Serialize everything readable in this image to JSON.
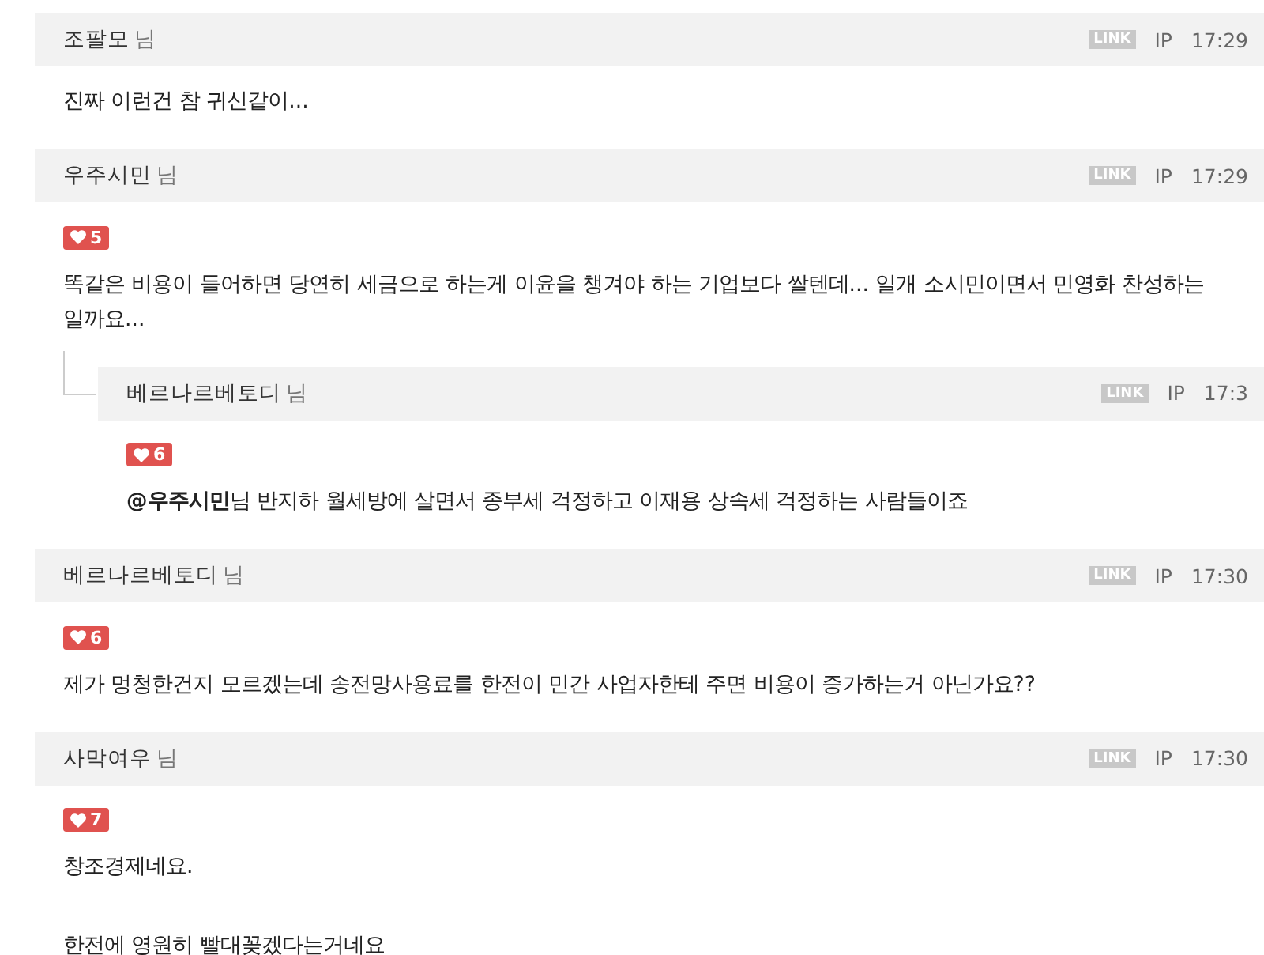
{
  "comments": [
    {
      "kind": "comment",
      "author": "조팔모",
      "suffix": "님",
      "link": "LINK",
      "ip": "IP",
      "time": "17:29",
      "paragraphs": [
        [
          "진짜 이런건 참 귀신같이..."
        ]
      ]
    },
    {
      "kind": "comment",
      "author": "우주시민",
      "suffix": "님",
      "link": "LINK",
      "ip": "IP",
      "time": "17:29",
      "likes": "5",
      "paragraphs": [
        [
          "똑같은 비용이 들어하면 당연히 세금으로 하는게 이윤을 챙겨야 하는 기업보다 쌀텐데... 일개 소시민이면서 민영화 찬성하는",
          "일까요..."
        ]
      ]
    },
    {
      "kind": "reply",
      "author": "베르나르베토디",
      "suffix": "님",
      "link": "LINK",
      "ip": "IP",
      "time": "17:3",
      "likes": "6",
      "paragraphs": [
        [
          "**@우주시민**님 반지하 월세방에 살면서 종부세 걱정하고 이재용 상속세 걱정하는 사람들이죠"
        ]
      ]
    },
    {
      "kind": "comment",
      "author": "베르나르베토디",
      "suffix": "님",
      "link": "LINK",
      "ip": "IP",
      "time": "17:30",
      "likes": "6",
      "paragraphs": [
        [
          "제가 멍청한건지 모르겠는데 송전망사용료를 한전이 민간 사업자한테 주면 비용이 증가하는거 아닌가요??"
        ]
      ]
    },
    {
      "kind": "comment",
      "author": "사막여우",
      "suffix": "님",
      "link": "LINK",
      "ip": "IP",
      "time": "17:30",
      "likes": "7",
      "paragraphs": [
        [
          "창조경제네요."
        ],
        [
          "한전에 영원히 빨대꽂겠다는거네요"
        ]
      ]
    }
  ]
}
